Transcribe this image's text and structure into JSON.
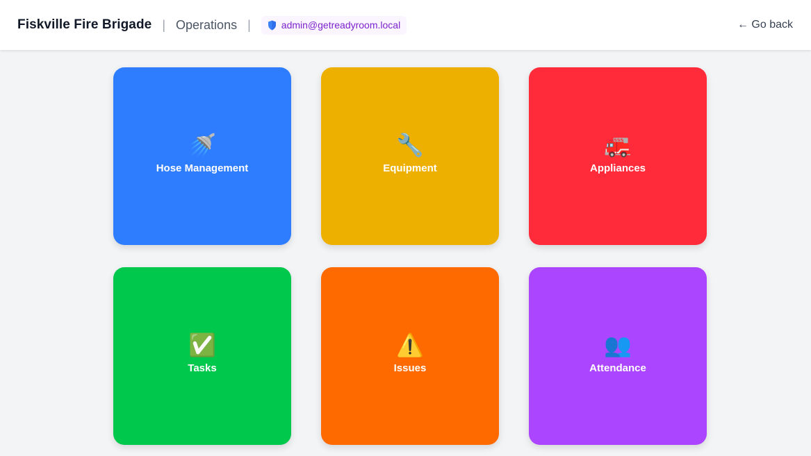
{
  "header": {
    "brand": "Fiskville Fire Brigade",
    "separator": "|",
    "section": "Operations",
    "user_icon": "shield-icon",
    "user_email": "admin@getreadyroom.local",
    "go_back": "← Go back"
  },
  "tiles": [
    {
      "label": "Hose Management",
      "icon_name": "shower-head-icon",
      "icon": "🚿",
      "color": "#2f7dff"
    },
    {
      "label": "Equipment",
      "icon_name": "wrench-icon",
      "icon": "🔧",
      "color": "#eeb000"
    },
    {
      "label": "Appliances",
      "icon_name": "fire-engine-icon",
      "icon": "🚒",
      "color": "#ff2b3a"
    },
    {
      "label": "Tasks",
      "icon_name": "check-box-icon",
      "icon": "✅",
      "color": "#00c84c"
    },
    {
      "label": "Issues",
      "icon_name": "warning-icon",
      "icon": "⚠️",
      "color": "#ff6a00"
    },
    {
      "label": "Attendance",
      "icon_name": "people-icon",
      "icon": "👥",
      "color": "#ac45ff"
    }
  ],
  "colors": {
    "background": "#f3f4f6",
    "header_bg": "#ffffff",
    "badge_bg": "#faf5ff",
    "badge_text": "#7e22ce"
  }
}
